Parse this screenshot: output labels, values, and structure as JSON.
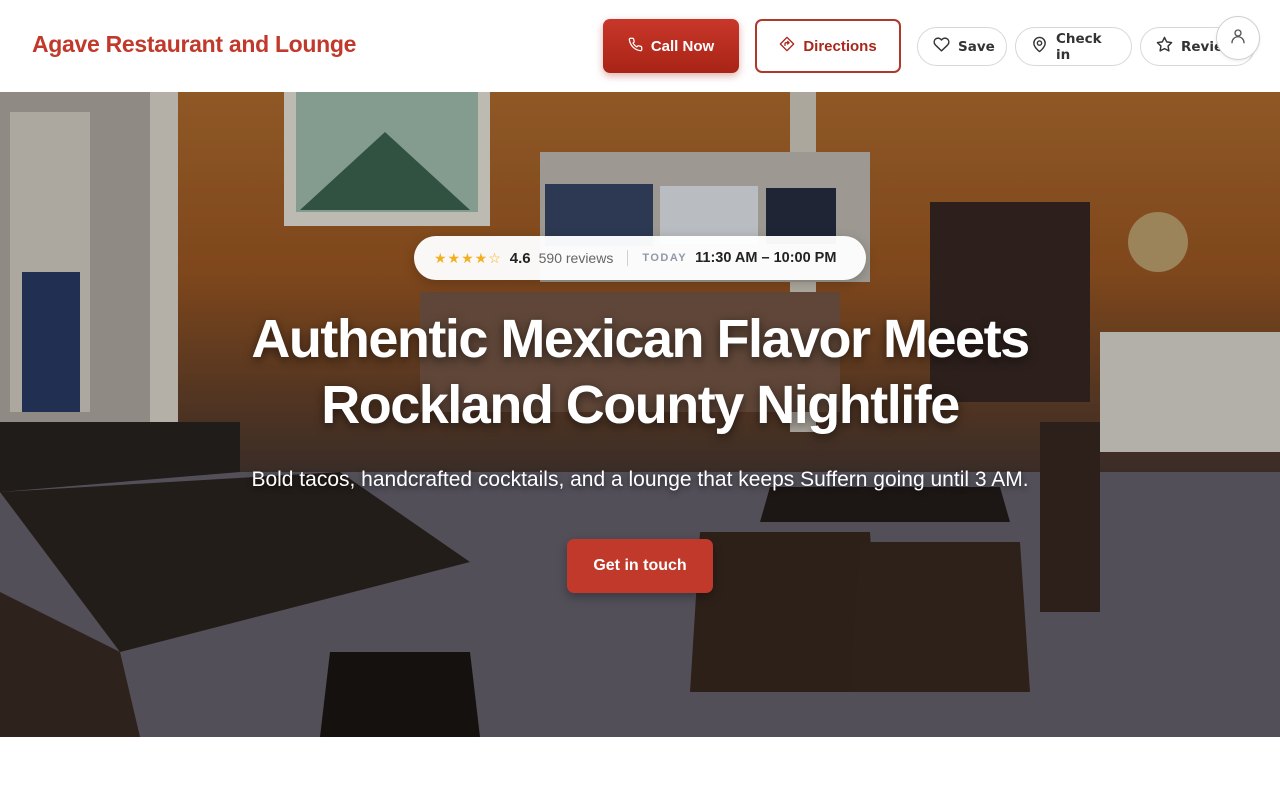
{
  "brand": {
    "name": "Agave Restaurant and Lounge"
  },
  "header": {
    "call_label": "Call Now",
    "directions_label": "Directions",
    "save_label": "Save",
    "checkin_label": "Check in",
    "review_label": "Review"
  },
  "hero": {
    "rating_stars": "★★★★☆",
    "rating": "4.6",
    "reviews": "590 reviews",
    "today_label": "TODAY",
    "hours": "11:30 AM – 10:00 PM",
    "headline_line1": "Authentic Mexican Flavor Meets",
    "headline_line2": "Rockland County Nightlife",
    "subheadline": "Bold tacos, handcrafted cocktails, and a lounge that keeps Suffern going until 3 AM.",
    "cta_label": "Get in touch"
  },
  "icons": {
    "call": "phone-icon",
    "directions": "directions-icon",
    "save": "heart-icon",
    "checkin": "map-pin-icon",
    "review": "star-icon",
    "account": "user-icon"
  },
  "colors": {
    "brand": "#c0392b",
    "primary_button": "#c0392b",
    "star": "#f2b01e"
  }
}
